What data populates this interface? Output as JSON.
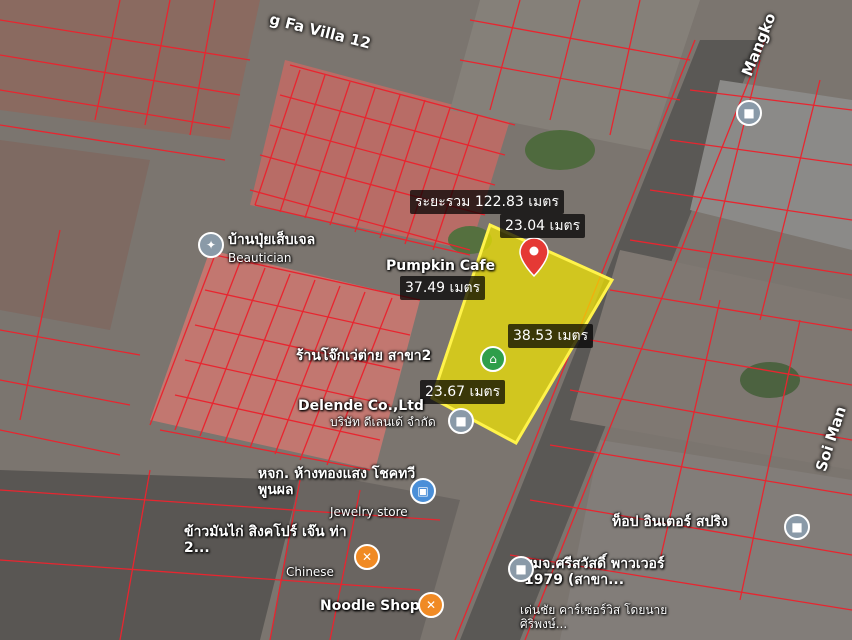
{
  "map": {
    "streets": {
      "soi_fa_villa": "g Fa Villa 12",
      "mangko": "Mangko",
      "soi_man": "Soi Man"
    },
    "measurements": {
      "total_label": "ระยะรวม 122.83 เมตร",
      "side_top": "23.04 เมตร",
      "side_left": "37.49 เมตร",
      "side_right": "38.53 เมตร",
      "side_bottom": "23.67 เมตร"
    },
    "pois": [
      {
        "id": "beautician",
        "name_th": "บ้านปุ่ยเส็บเจล",
        "name_en": "Beautician",
        "icon": "shop-icon"
      },
      {
        "id": "pumpkin",
        "name_th": "Pumpkin Cafe",
        "name_en": "",
        "icon": "cafe-icon"
      },
      {
        "id": "jok",
        "name_th": "ร้านโจ๊กเว่ต่าย สาขา2",
        "name_en": "",
        "icon": "restaurant-icon"
      },
      {
        "id": "delende",
        "name_th": "Delende Co.,Ltd",
        "name_en": "บริษัท ดีเลนเด้ จำกัด",
        "icon": "business-icon"
      },
      {
        "id": "gold",
        "name_th": "หจก. ห้างทองแสง โชคทวีพูนผล",
        "name_en": "Jewelry store",
        "icon": "shopping-bag-icon"
      },
      {
        "id": "chicken_rice",
        "name_th": "ข้าวมันไก่ สิงคโปร์ เจ๊น ท่า 2...",
        "name_en": "Chinese",
        "icon": "food-icon"
      },
      {
        "id": "noodle",
        "name_th": "Noodle Shop",
        "name_en": "",
        "icon": "food-icon"
      },
      {
        "id": "top_inter",
        "name_th": "ท็อป อินเตอร์ สปริง",
        "name_en": "",
        "icon": "business-icon"
      },
      {
        "id": "srisawad",
        "name_th": "บมจ.ศรีสวัสดิ์ พาวเวอร์ 1979 (สาขา...",
        "name_en": "",
        "icon": "business-icon"
      },
      {
        "id": "car_rental",
        "name_th": "เด่นชัย คาร์เซอร์วิส โดยนายศิริพงษ์...",
        "name_en": "",
        "icon": "business-icon"
      }
    ],
    "colors": {
      "parcel_line": "#e8252f",
      "highlight": "#f2e600",
      "pin": "#e53935"
    }
  }
}
